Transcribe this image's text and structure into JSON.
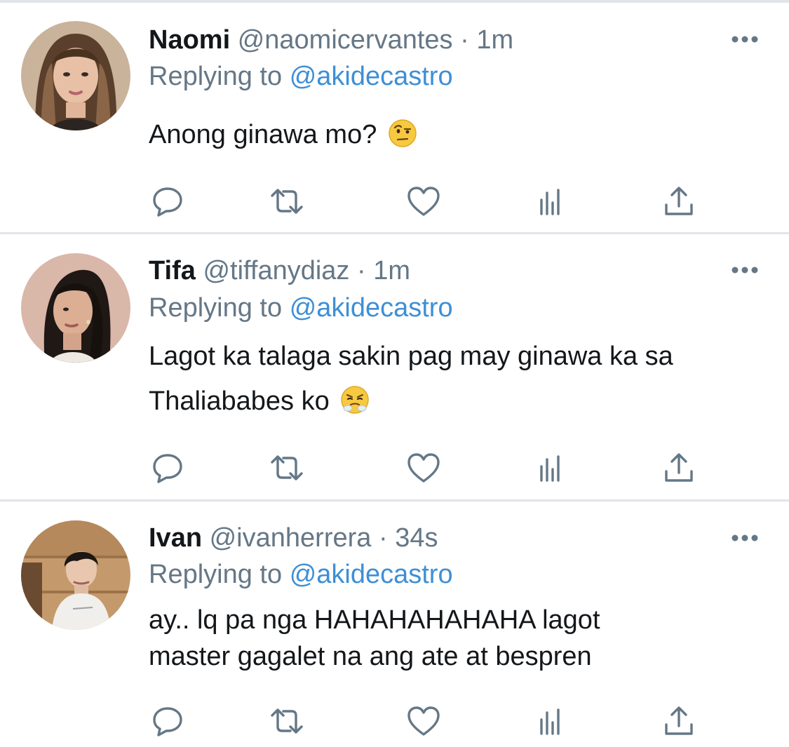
{
  "colors": {
    "text": "#14171a",
    "secondary": "#657786",
    "link": "#3e8fd6",
    "divider": "#e1e4e8"
  },
  "icons": [
    "reply-icon",
    "retweet-icon",
    "like-icon",
    "analytics-icon",
    "share-icon",
    "more-icon"
  ],
  "tweets": [
    {
      "name": "Naomi",
      "handle": "@naomicervantes",
      "separator": "·",
      "time": "1m",
      "replying_prefix": "Replying to",
      "replying_to": "@akidecastro",
      "lines": [
        "Anong ginawa mo?"
      ],
      "emoji": "face-with-raised-eyebrow"
    },
    {
      "name": "Tifa",
      "handle": "@tiffanydiaz",
      "separator": "·",
      "time": "1m",
      "replying_prefix": "Replying to",
      "replying_to": "@akidecastro",
      "lines": [
        "Lagot ka talaga sakin pag may ginawa ka sa",
        "Thaliababes ko"
      ],
      "emoji": "face-with-steam-from-nose"
    },
    {
      "name": "Ivan",
      "handle": "@ivanherrera",
      "separator": "·",
      "time": "34s",
      "replying_prefix": "Replying to",
      "replying_to": "@akidecastro",
      "lines": [
        "ay.. lq pa nga HAHAHAHAHAHA lagot",
        "master gagalet na ang ate at bespren"
      ],
      "emoji": ""
    }
  ]
}
